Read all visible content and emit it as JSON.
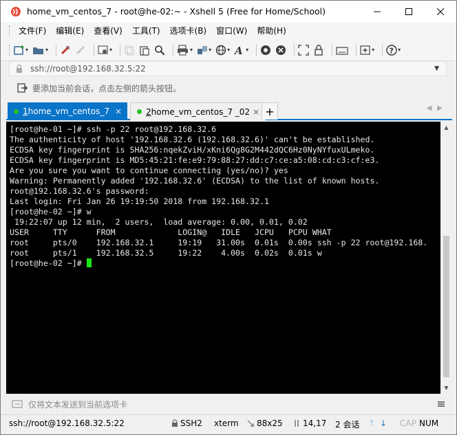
{
  "window": {
    "title": "home_vm_centos_7 - root@he-02:~ - Xshell 5 (Free for Home/School)"
  },
  "menu": [
    "文件(F)",
    "编辑(E)",
    "查看(V)",
    "工具(T)",
    "选项卡(B)",
    "窗口(W)",
    "帮助(H)"
  ],
  "address": {
    "value": "ssh://root@192.168.32.5:22"
  },
  "hint": {
    "text": "要添加当前会话，点击左侧的箭头按钮。"
  },
  "tabs": [
    {
      "num": "1",
      "label": " home_vm_centos_7",
      "active": true
    },
    {
      "num": "2",
      "label": " home_vm_centos_7 _02",
      "active": false
    }
  ],
  "tab_close": "×",
  "tab_add": "+",
  "terminal": {
    "lines": [
      "[root@he-01 ~]# ssh -p 22 root@192.168.32.6",
      "The authenticity of host '192.168.32.6 (192.168.32.6)' can't be established.",
      "ECDSA key fingerprint is SHA256:nqekZviH/xKni6Qg8G2M442dQC6Hz0NyNYfuxULmeko.",
      "ECDSA key fingerprint is MD5:45:21:fe:e9:79:88:27:dd:c7:ce:a5:08:cd:c3:cf:e3.",
      "Are you sure you want to continue connecting (yes/no)? yes",
      "Warning: Permanently added '192.168.32.6' (ECDSA) to the list of known hosts.",
      "root@192.168.32.6's password:",
      "Last login: Fri Jan 26 19:19:50 2018 from 192.168.32.1",
      "[root@he-02 ~]# w",
      " 19:22:07 up 12 min,  2 users,  load average: 0.00, 0.01, 0.02",
      "USER     TTY      FROM             LOGIN@   IDLE   JCPU   PCPU WHAT",
      "root     pts/0    192.168.32.1     19:19   31.00s  0.01s  0.00s ssh -p 22 root@192.168.",
      "root     pts/1    192.168.32.5     19:22    4.00s  0.02s  0.01s w"
    ],
    "prompt": "[root@he-02 ~]# "
  },
  "sendbar": {
    "text": "仅将文本发送到当前选项卡"
  },
  "status": {
    "connection": "ssh://root@192.168.32.5:22",
    "protocol": "SSH2",
    "term": "xterm",
    "size": "88x25",
    "cursor": "14,17",
    "sessions": "2 会话",
    "caps": "CAP",
    "num": "NUM"
  },
  "colors": {
    "tab_active": "#0a74c9",
    "cursor": "#19e619",
    "status_dot": "#23c223"
  }
}
